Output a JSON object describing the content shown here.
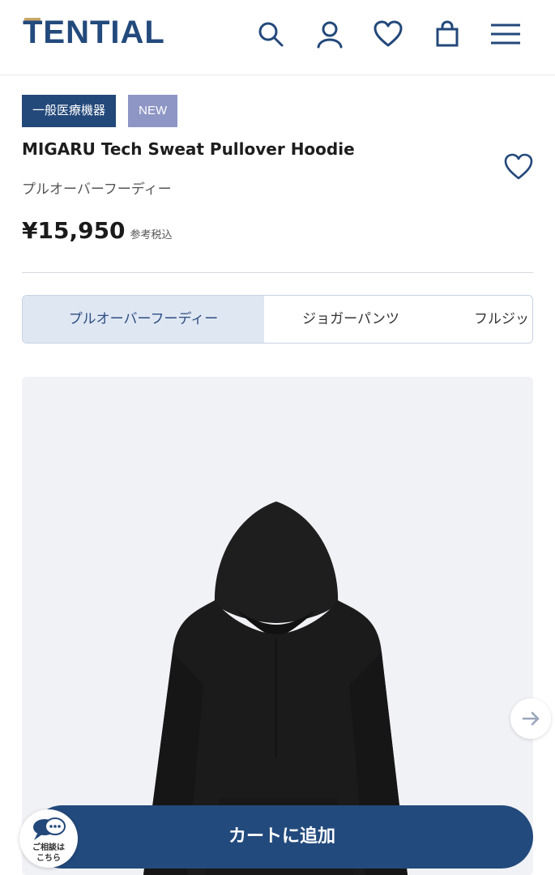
{
  "header": {
    "logo_text": "TENTIAL",
    "icons": [
      "search-icon",
      "account-icon",
      "favorites-icon",
      "cart-icon",
      "menu-icon"
    ],
    "brand_color": "#234a7d"
  },
  "product": {
    "badges": [
      "一般医療機器",
      "NEW"
    ],
    "title": "MIGARU Tech Sweat Pullover Hoodie",
    "subtitle": "プルオーバーフーディー",
    "price": "¥15,950",
    "tax_note": "参考税込"
  },
  "variant_tabs": [
    {
      "label": "プルオーバーフーディー",
      "active": true
    },
    {
      "label": "ジョガーパンツ",
      "active": false
    },
    {
      "label": "フルジッ",
      "active": false
    }
  ],
  "gallery": {
    "next_icon": "arrow-right-icon"
  },
  "cta": {
    "add_to_cart": "カートに追加"
  },
  "consult": {
    "line1": "ご相談は",
    "line2": "こちら",
    "icon": "chat-bubble-icon"
  }
}
